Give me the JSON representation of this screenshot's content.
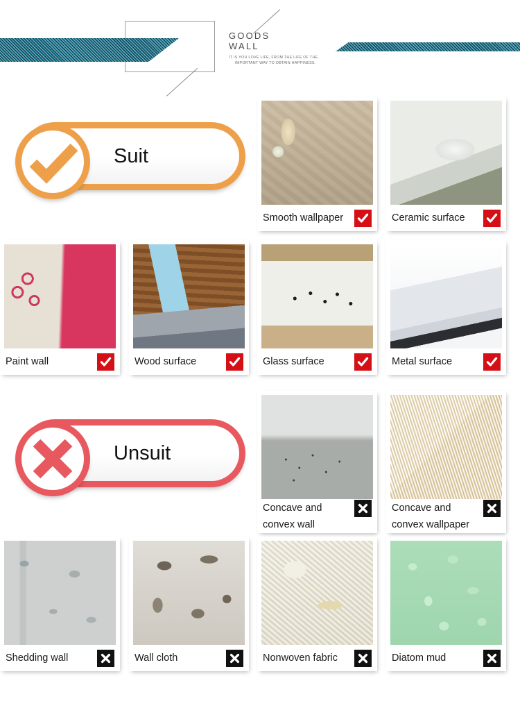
{
  "header": {
    "title_line1": "GOODS",
    "title_line2": "WALL",
    "tagline_line1": "IT IS YOU LOVE LIFE, FROM THE LIFE OF THE",
    "tagline_line2": "IMPORTANT WAY TO OBTAIN HAPPINESS."
  },
  "sections": [
    {
      "id": "suit",
      "label": "Suit",
      "color": "#eda049",
      "mark": "check-mark-icon",
      "badge_kind": "yes"
    },
    {
      "id": "unsuit",
      "label": "Unsuit",
      "color": "#e8585f",
      "mark": "cross-mark-icon",
      "badge_kind": "no"
    }
  ],
  "badges": {
    "yes_color": "#d50f16",
    "no_color": "#111111",
    "yes_icon": "white-check-icon",
    "no_icon": "white-x-icon"
  },
  "cards": [
    {
      "label": "Smooth wallpaper",
      "verdict": "yes",
      "texture": "px-smooth-wallpaper"
    },
    {
      "label": "Ceramic surface",
      "verdict": "yes",
      "texture": "px-ceramic"
    },
    {
      "label": "Paint wall",
      "verdict": "yes",
      "texture": "px-paint"
    },
    {
      "label": "Wood surface",
      "verdict": "yes",
      "texture": "px-wood"
    },
    {
      "label": "Glass surface",
      "verdict": "yes",
      "texture": "px-glass"
    },
    {
      "label": "Metal surface",
      "verdict": "yes",
      "texture": "px-metal"
    },
    {
      "label": "Concave and convex wall",
      "verdict": "no",
      "texture": "px-concave-wall"
    },
    {
      "label": "Concave and convex wallpaper",
      "verdict": "no",
      "texture": "px-concave-wp"
    },
    {
      "label": "Shedding wall",
      "verdict": "no",
      "texture": "px-shedding"
    },
    {
      "label": "Wall cloth",
      "verdict": "no",
      "texture": "px-wallcloth"
    },
    {
      "label": "Nonwoven fabric",
      "verdict": "no",
      "texture": "px-nonwoven"
    },
    {
      "label": "Diatom mud",
      "verdict": "no",
      "texture": "px-diatom"
    }
  ],
  "card_labels": {
    "concave_wall_l1": "Concave and",
    "concave_wall_l2": "convex wall",
    "concave_wp_l1": "Concave and",
    "concave_wp_l2": "convex wallpaper"
  }
}
